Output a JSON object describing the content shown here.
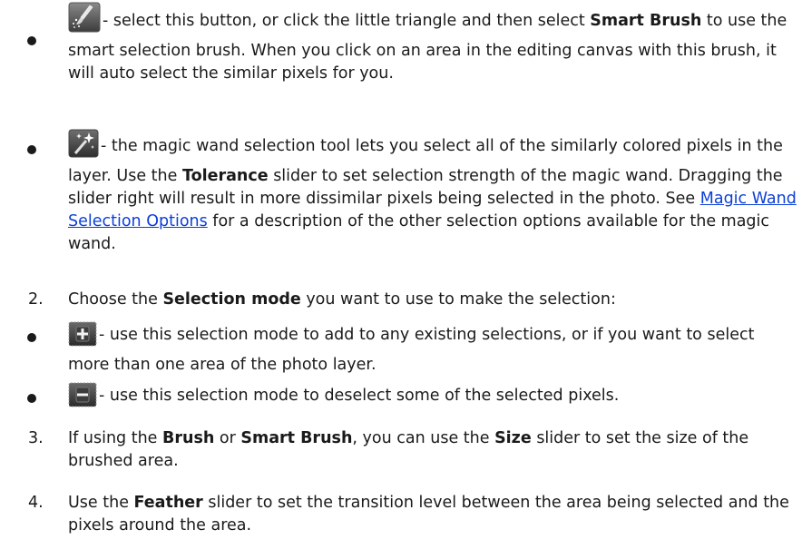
{
  "bullet_smart_brush": {
    "icon": "smart-brush-icon",
    "t1": "- select this button, or click the little triangle and then select ",
    "b1": "Smart Brush",
    "t2": " to use the smart selection brush. When you click on an area in the editing canvas with this brush, it will auto select the similar pixels for you."
  },
  "bullet_magic_wand": {
    "icon": "magic-wand-icon",
    "t1": "- the magic wand selection tool lets you select all of the similarly colored pixels in the layer. Use the ",
    "b1": "Tolerance",
    "t2": " slider to set selection strength of the magic wand. Dragging the slider right will result in more dissimilar pixels being selected in the photo. See ",
    "link": "Magic Wand Selection Options",
    "t3": " for a description of the other selection options available for the magic wand."
  },
  "step2": {
    "num": "2.",
    "t1": "Choose the ",
    "b1": "Selection mode",
    "t2": " you want to use to make the selection:"
  },
  "bullet_add": {
    "icon": "add-selection-icon",
    "t1": "- use this selection mode to add to any existing selections, or if you want to select more than one area of the photo layer."
  },
  "bullet_subtract": {
    "icon": "subtract-selection-icon",
    "t1": "- use this selection mode to deselect some of the selected pixels."
  },
  "step3": {
    "num": "3.",
    "t1": "If using the ",
    "b1": "Brush",
    "t2": " or ",
    "b2": "Smart Brush",
    "t3": ", you can use the ",
    "b3": "Size",
    "t4": " slider to set the size of the brushed area."
  },
  "step4": {
    "num": "4.",
    "t1": "Use the ",
    "b1": "Feather",
    "t2": " slider to set the transition level between the area being selected and the pixels around the area."
  }
}
